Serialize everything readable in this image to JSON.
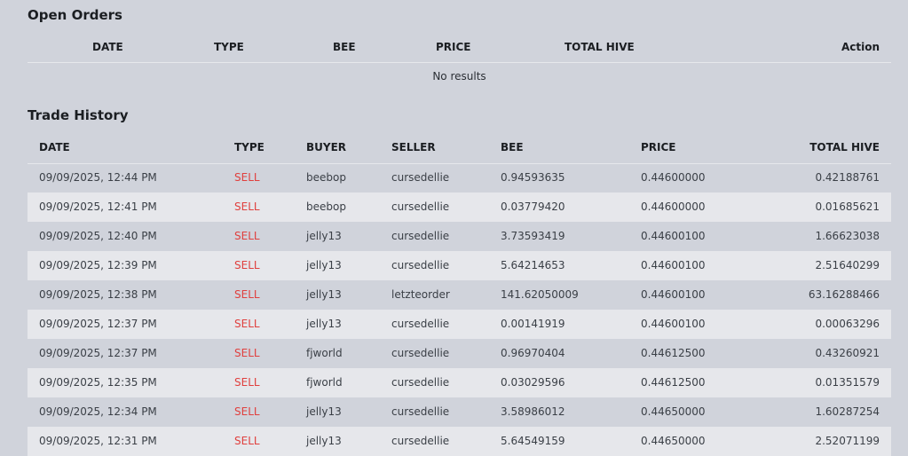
{
  "open_orders": {
    "title": "Open Orders",
    "columns": [
      "DATE",
      "TYPE",
      "BEE",
      "PRICE",
      "TOTAL HIVE",
      "Action"
    ],
    "empty_text": "No results"
  },
  "trade_history": {
    "title": "Trade History",
    "columns": [
      "DATE",
      "TYPE",
      "BUYER",
      "SELLER",
      "BEE",
      "PRICE",
      "TOTAL HIVE"
    ],
    "rows": [
      {
        "date": "09/09/2025, 12:44 PM",
        "type": "SELL",
        "buyer": "beebop",
        "seller": "cursedellie",
        "bee": "0.94593635",
        "price": "0.44600000",
        "total": "0.42188761"
      },
      {
        "date": "09/09/2025, 12:41 PM",
        "type": "SELL",
        "buyer": "beebop",
        "seller": "cursedellie",
        "bee": "0.03779420",
        "price": "0.44600000",
        "total": "0.01685621"
      },
      {
        "date": "09/09/2025, 12:40 PM",
        "type": "SELL",
        "buyer": "jelly13",
        "seller": "cursedellie",
        "bee": "3.73593419",
        "price": "0.44600100",
        "total": "1.66623038"
      },
      {
        "date": "09/09/2025, 12:39 PM",
        "type": "SELL",
        "buyer": "jelly13",
        "seller": "cursedellie",
        "bee": "5.64214653",
        "price": "0.44600100",
        "total": "2.51640299"
      },
      {
        "date": "09/09/2025, 12:38 PM",
        "type": "SELL",
        "buyer": "jelly13",
        "seller": "letzteorder",
        "bee": "141.62050009",
        "price": "0.44600100",
        "total": "63.16288466"
      },
      {
        "date": "09/09/2025, 12:37 PM",
        "type": "SELL",
        "buyer": "jelly13",
        "seller": "cursedellie",
        "bee": "0.00141919",
        "price": "0.44600100",
        "total": "0.00063296"
      },
      {
        "date": "09/09/2025, 12:37 PM",
        "type": "SELL",
        "buyer": "fjworld",
        "seller": "cursedellie",
        "bee": "0.96970404",
        "price": "0.44612500",
        "total": "0.43260921"
      },
      {
        "date": "09/09/2025, 12:35 PM",
        "type": "SELL",
        "buyer": "fjworld",
        "seller": "cursedellie",
        "bee": "0.03029596",
        "price": "0.44612500",
        "total": "0.01351579"
      },
      {
        "date": "09/09/2025, 12:34 PM",
        "type": "SELL",
        "buyer": "jelly13",
        "seller": "cursedellie",
        "bee": "3.58986012",
        "price": "0.44650000",
        "total": "1.60287254"
      },
      {
        "date": "09/09/2025, 12:31 PM",
        "type": "SELL",
        "buyer": "jelly13",
        "seller": "cursedellie",
        "bee": "5.64549159",
        "price": "0.44650000",
        "total": "2.52071199"
      }
    ]
  },
  "colors": {
    "background": "#d0d3db",
    "row_alt": "#e6e7eb",
    "sell": "#e0403e"
  }
}
